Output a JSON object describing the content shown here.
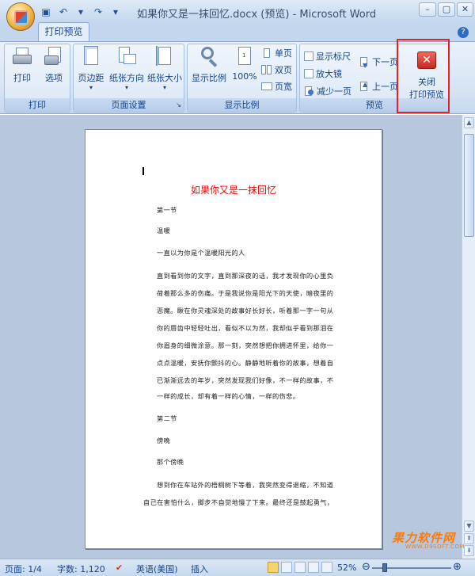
{
  "window": {
    "title": "如果你又是一抹回忆.docx (预览) - Microsoft Word",
    "help": "?"
  },
  "ribbon": {
    "active_tab": "打印预览",
    "groups": {
      "print": {
        "title": "打印",
        "print": "打印",
        "options": "选项"
      },
      "page_setup": {
        "title": "页面设置",
        "margins": "页边距",
        "orientation": "纸张方向",
        "size": "纸张大小"
      },
      "zoom": {
        "title": "显示比例",
        "zoom": "显示比例",
        "hundred": "100%",
        "one_page": "单页",
        "two_pages": "双页",
        "page_width": "页宽"
      },
      "preview": {
        "title": "预览",
        "show_ruler": "显示标尺",
        "magnifier": "放大镜",
        "shrink_one_page": "减少一页",
        "next_page": "下一页",
        "previous_page": "上一页",
        "close_line1": "关闭",
        "close_line2": "打印预览"
      }
    }
  },
  "document": {
    "heading": "如果你又是一抹回忆",
    "lines": [
      "第一节",
      "温暖",
      "一直以为你是个温暖阳光的人",
      "直到看到你的文字，直到那深夜的话，我才发现你的心里负",
      "荷着那么多的伤痛。于是我说你是阳光下的天使，暗夜里的",
      "恶魔。瞅在你灵魂深处的故事好长好长，听着那一字一句从",
      "你的唇齿中轻轻吐出，看似不以为然，我却似乎看到那泪在",
      "你眉身的细微涂意。那一刻，突然想把你拥进怀里，给你一",
      "点点温暖，安抚你颤抖的心。静静地听着你的故事，想着自",
      "已渐渐远去的年岁，突然发现我们好像，不一样的故事，不",
      "一样的成长，却有着一样的心情，一样的伤悲。",
      "第二节",
      "傍晚",
      "那个傍晚",
      "想到你在车站外的梧桐树下等着，我突然变得退缩，不知道",
      "自己在害怕什么，脚步不自觉地慢了下来。最终还是鼓起勇气，"
    ]
  },
  "status": {
    "page": "页面: 1/4",
    "words": "字数: 1,120",
    "language": "英语(美国)",
    "insert": "插入",
    "zoom": "52%"
  },
  "watermark": {
    "main": "果力软件网",
    "url": "WWW.D9SOFT.COM"
  },
  "colors": {
    "heading": "#ff0000",
    "highlight": "#e5222a",
    "watermark": "#ff7a00"
  }
}
